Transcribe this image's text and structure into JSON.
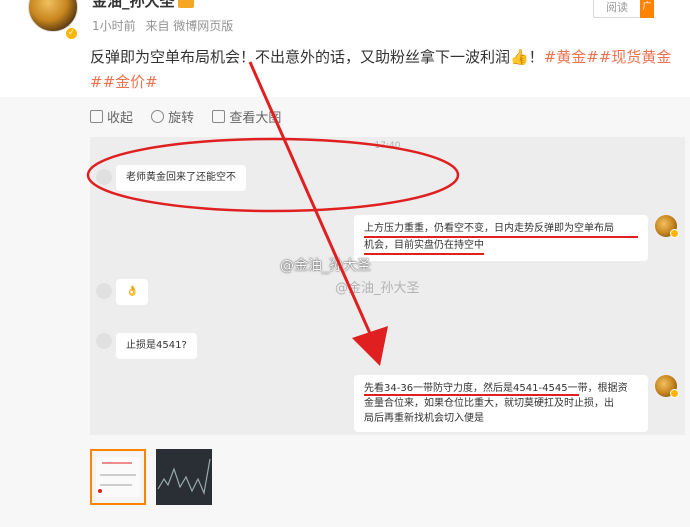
{
  "header": {
    "username": "金油_孙大圣",
    "meta": {
      "time": "1小时前",
      "source": "来自 微博网页版"
    },
    "read_label": "阅读",
    "ad_label": "广"
  },
  "post": {
    "text": "反弹即为空单布局机会！不出意外的话，又助粉丝拿下一波利润👍！",
    "tags": [
      "#黄金#",
      "#现货黄金#",
      "#金价#"
    ]
  },
  "toolbar": {
    "collapse": "收起",
    "rotate": "旋转",
    "view_large": "查看大图"
  },
  "chat": {
    "timestamp": "17:40",
    "msg1": "老师黄金回来了还能空不",
    "reply1_line1": "上方压力重重，仍看空不变，日内走势反弹即为空单布局",
    "reply1_line2": "机会，目前实盘仍在持空中",
    "msg2": "👌",
    "msg3": "止损是4541?",
    "reply2_line1": "先看34-36一带防守力度，然后是4541-4545一带，根据资",
    "reply2_line2": "金量合位来，如果仓位比重大，就切莫硬扛及时止损，出",
    "reply2_line3": "局后再重新找机会切入便是"
  },
  "watermark": {
    "main": "@金油_孙大圣",
    "sub": "@金油_孙大圣"
  },
  "colors": {
    "accent": "#eb7350",
    "annotation": "#e02020",
    "ad": "#ff8200"
  }
}
